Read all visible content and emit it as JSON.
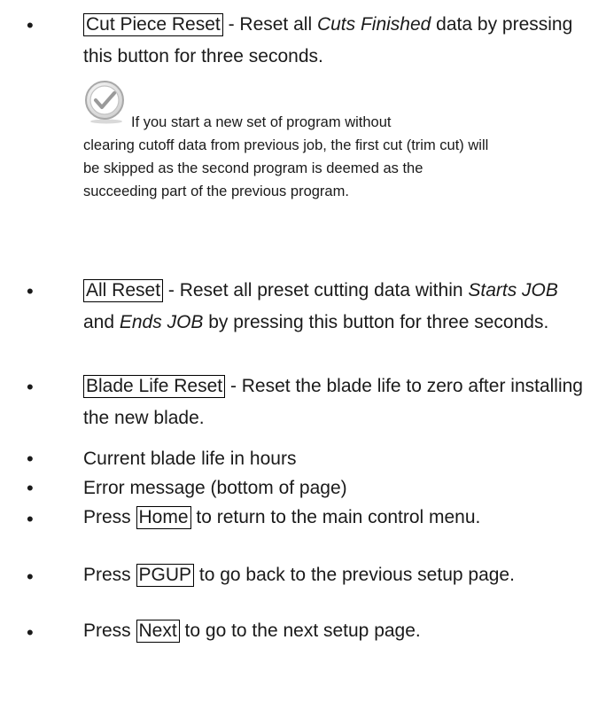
{
  "items": [
    {
      "button": "Cut Piece Reset",
      "text_before_em": " - Reset all ",
      "em": "Cuts Finished",
      "text_after_em": " data by pressing this button for three seconds."
    },
    {
      "button": "All Reset",
      "text_a": " - Reset all preset cutting data within ",
      "em1": "Starts JOB",
      "text_b": " and ",
      "em2": "Ends JOB",
      "text_c": " by pressing this button for three seconds."
    },
    {
      "button": "Blade Life Reset",
      "text": " - Reset the blade life to zero after installing the new blade."
    },
    {
      "text": "Current blade life in hours"
    },
    {
      "text": "Error message (bottom of page)"
    },
    {
      "before": "Press ",
      "button": "Home",
      "after": " to return to the main control menu."
    },
    {
      "before": "Press ",
      "button": "PGUP",
      "after": " to go back to the previous setup page."
    },
    {
      "before": "Press ",
      "button": "Next",
      "after": " to go to the next setup page."
    }
  ],
  "note": {
    "icon": "checkmark-circle-icon",
    "line1": "If you start a new set of program without",
    "rest": "clearing cutoff data from previous job, the first cut (trim cut) will be skipped as the second program is deemed as the succeeding part of the previous program."
  },
  "bullet_char": "•"
}
